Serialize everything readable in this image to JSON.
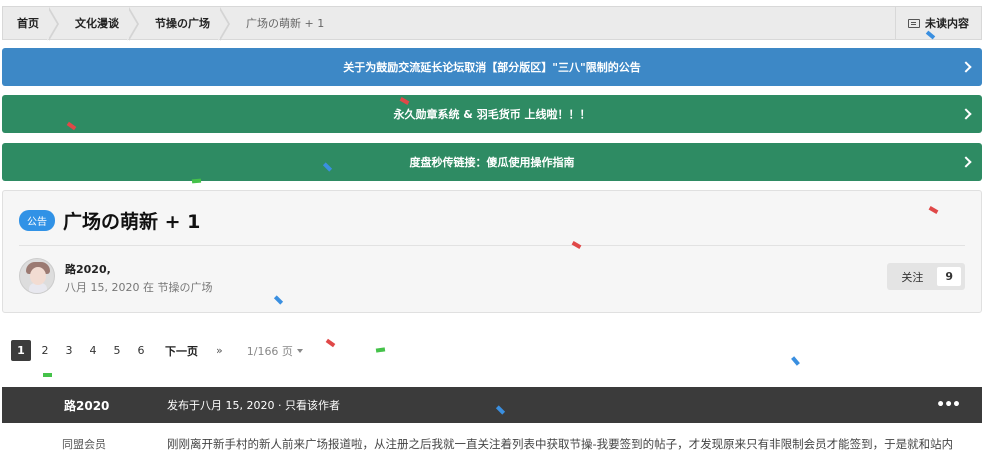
{
  "breadcrumb": {
    "items": [
      "首页",
      "文化漫谈",
      "节操の广场"
    ],
    "current": "广场の萌新 + 1",
    "unread_label": "未读内容"
  },
  "banners": [
    {
      "text": "关于为鼓励交流延长论坛取消【部分版区】\"三八\"限制的公告",
      "color": "#3d88c6"
    },
    {
      "text": "永久勋章系统 & 羽毛货币 上线啦！！！",
      "color": "#2e8b63"
    },
    {
      "text": "度盘秒传链接：傻瓜使用操作指南",
      "color": "#2e8b63"
    }
  ],
  "topic": {
    "tag": "公告",
    "title": "广场の萌新 + 1",
    "author": "路2020,",
    "meta": "八月 15, 2020 在 节操の广场",
    "follow_label": "关注",
    "follow_count": "9"
  },
  "pagination": {
    "pages": [
      "1",
      "2",
      "3",
      "4",
      "5",
      "6"
    ],
    "active": "1",
    "next": "下一页",
    "last": "»",
    "count": "1/166 页"
  },
  "post": {
    "author": "路2020",
    "date": "发布于八月 15, 2020 · 只看该作者",
    "menu": "•••",
    "role": "同盟会员",
    "text": "刚刚离开新手村的新人前来广场报道啦，从注册之后我就一直关注着列表中获取节操-我要签到的帖子，才发现原来只有非限制会员才能签到，于是就和站内"
  },
  "colors": {
    "blue_banner": "#3d88c6",
    "green_banner": "#2e8b63",
    "post_bar": "#3b3b3b",
    "tag": "#3192e6"
  }
}
